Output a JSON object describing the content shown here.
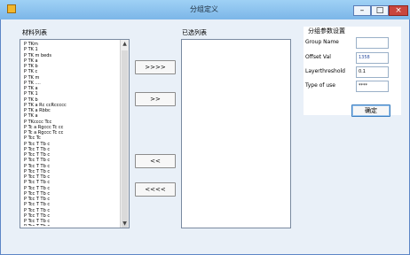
{
  "window": {
    "title": "分组定义",
    "controls": {
      "minimize": "–",
      "maximize": "□",
      "close": "×"
    }
  },
  "left_list": {
    "label": "材料列表",
    "items": [
      "P  TKm",
      "P  TK 1",
      "P  TK m  beds",
      "P  TK a",
      "P  TK b",
      "P  TK c",
      "P  TK m",
      "P  TK  ....",
      "P  TK a",
      "P  TK 1",
      "P  TK b",
      "P  TK a  Rc  ccRccccc",
      "P  TK a  Rbbc",
      "P  TK a",
      "P  TKcccc  Tcc",
      "P  Tc a  Rgccc  Tc  cc",
      "P  Tc a  Rgccc  Tc  cc",
      "P  Tcc  Tc",
      "P  Tcc  T  Tb  c",
      "P  Tcc  T  Tb  c",
      "P  Tcc  T  Tb  c",
      "P  Tcc  T  Tb  c",
      "P  Tcc  T  Tb  c",
      "P  Tcc  T  Tb  c",
      "P  Tcc  T  Tb  c",
      "P  Tcc  T  Tb  c",
      "P  Tcc  T  Tb  c",
      "P  Tcc  T  Tb  c",
      "P  Tcc  T  Tb  c",
      "P  Tcc  T  Tb  c",
      "P  Tcc  T  Tb  c",
      "P  Tcc  T  Tb  c",
      "P  Tcc  T  Tb  c",
      "P  Tcc  T  Tb  c"
    ]
  },
  "transfer_buttons": {
    "add_all": ">>>>",
    "add_one": ">>",
    "remove_one": "<<",
    "remove_all": "<<<<"
  },
  "right_list": {
    "label": "已选列表",
    "items": []
  },
  "params": {
    "heading": "分组参数设置",
    "fields": [
      {
        "label": "Group Name",
        "value": ""
      },
      {
        "label": "Offset  Val",
        "value": "1358"
      },
      {
        "label": "Layerthreshold",
        "value": "0.1"
      },
      {
        "label": "Type of  use",
        "value": "****"
      }
    ],
    "ok_label": "确定"
  }
}
